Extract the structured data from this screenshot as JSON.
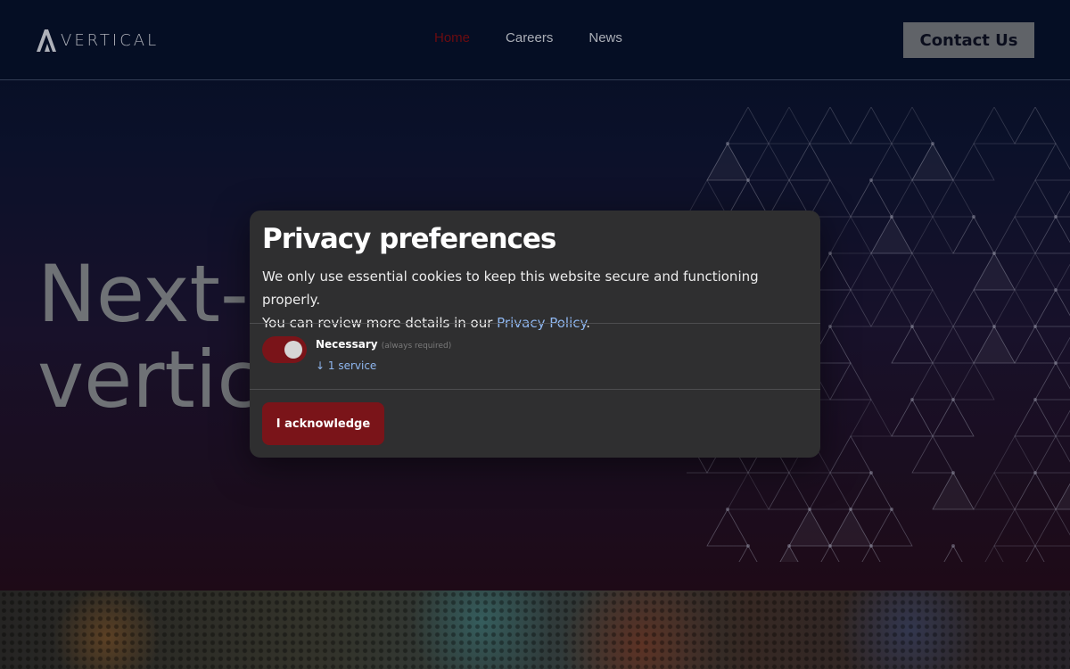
{
  "header": {
    "logo_text": "VERTICAL",
    "nav": [
      {
        "label": "Home",
        "active": true
      },
      {
        "label": "Careers",
        "active": false
      },
      {
        "label": "News",
        "active": false
      }
    ],
    "contact_label": "Contact Us"
  },
  "hero": {
    "title": "Next-\nvertica"
  },
  "dialog": {
    "title": "Privacy preferences",
    "desc_line1": "We only use essential cookies to keep this website secure and functioning properly.",
    "desc_line2_prefix": "You can review more details in our ",
    "privacy_link": "Privacy Policy",
    "desc_line2_suffix": ".",
    "service": {
      "name": "Necessary",
      "required_note": "(always required)",
      "count_label": "↓ 1 service",
      "enabled": true
    },
    "acknowledge_label": "I acknowledge"
  },
  "colors": {
    "accent": "#7a1419",
    "link": "#8fb7f0",
    "nav_active": "#7a0d13"
  }
}
